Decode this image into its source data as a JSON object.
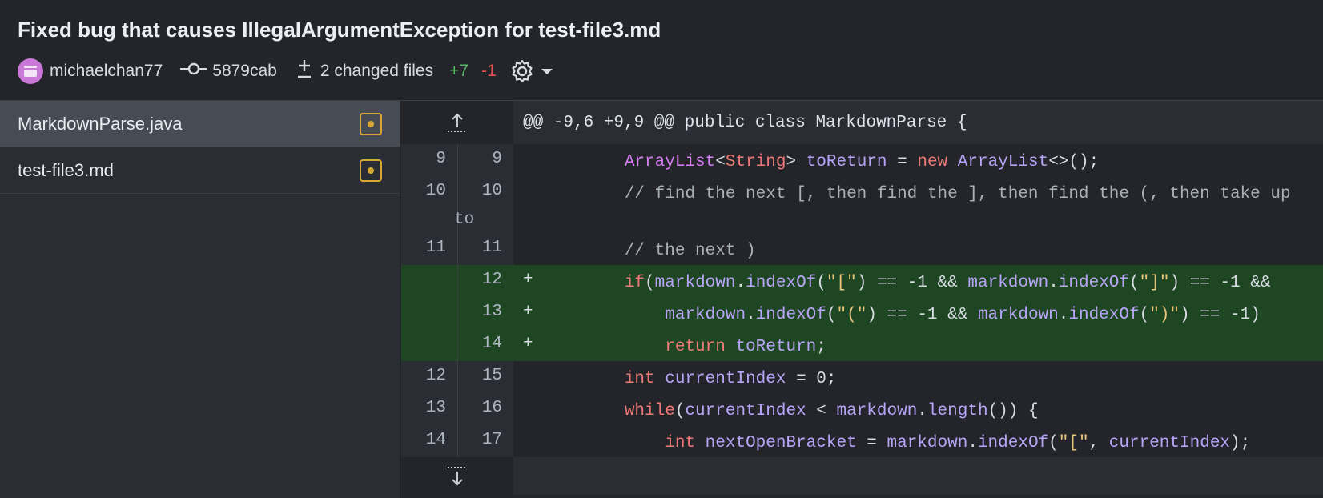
{
  "commit": {
    "title": "Fixed bug that causes IllegalArgumentException for test-file3.md",
    "author": "michaelchan77",
    "sha": "5879cab",
    "changed_files": "2 changed files",
    "additions": "+7",
    "deletions": "-1"
  },
  "files": [
    {
      "name": "MarkdownParse.java",
      "status": "modified",
      "active": true
    },
    {
      "name": "test-file3.md",
      "status": "modified",
      "active": false
    }
  ],
  "diff": {
    "hunk_header": "@@ -9,6 +9,9 @@ public class MarkdownParse {",
    "lines": [
      {
        "old": "9",
        "new": "9",
        "sign": "",
        "type": "context"
      },
      {
        "old": "10",
        "new": "10",
        "sign": "",
        "type": "context"
      },
      {
        "old": "11",
        "new": "11",
        "sign": "",
        "type": "context"
      },
      {
        "old": "",
        "new": "12",
        "sign": "+",
        "type": "added"
      },
      {
        "old": "",
        "new": "13",
        "sign": "+",
        "type": "added"
      },
      {
        "old": "",
        "new": "14",
        "sign": "+",
        "type": "added"
      },
      {
        "old": "12",
        "new": "15",
        "sign": "",
        "type": "context"
      },
      {
        "old": "13",
        "new": "16",
        "sign": "",
        "type": "context"
      },
      {
        "old": "14",
        "new": "17",
        "sign": "",
        "type": "context"
      }
    ],
    "code": {
      "l1_a": "ArrayList",
      "l1_b": "<",
      "l1_c": "String",
      "l1_d": "> ",
      "l1_e": "toReturn",
      "l1_f": " = ",
      "l1_g": "new",
      "l1_h": " ",
      "l1_i": "ArrayList",
      "l1_j": "<>();",
      "l2": "// find the next [, then find the ], then find the (, then take up",
      "l2_wrap": "to",
      "l3": "// the next )",
      "l4_a": "if",
      "l4_b": "(",
      "l4_c": "markdown",
      "l4_d": ".",
      "l4_e": "indexOf",
      "l4_f": "(",
      "l4_g": "\"[\"",
      "l4_h": ") == -1 && ",
      "l4_i": "markdown",
      "l4_j": ".",
      "l4_k": "indexOf",
      "l4_l": "(",
      "l4_m": "\"]\"",
      "l4_n": ") == -1 &&",
      "l5_a": "markdown",
      "l5_b": ".",
      "l5_c": "indexOf",
      "l5_d": "(",
      "l5_e": "\"(\"",
      "l5_f": ") == -1 && ",
      "l5_g": "markdown",
      "l5_h": ".",
      "l5_i": "indexOf",
      "l5_j": "(",
      "l5_k": "\")\"",
      "l5_l": ") == -1)",
      "l6_a": "return",
      "l6_b": " ",
      "l6_c": "toReturn",
      "l6_d": ";",
      "l7_a": "int",
      "l7_b": " ",
      "l7_c": "currentIndex",
      "l7_d": " = 0;",
      "l8_a": "while",
      "l8_b": "(",
      "l8_c": "currentIndex",
      "l8_d": " < ",
      "l8_e": "markdown",
      "l8_f": ".",
      "l8_g": "length",
      "l8_h": "()) {",
      "l9_a": "int",
      "l9_b": " ",
      "l9_c": "nextOpenBracket",
      "l9_d": " = ",
      "l9_e": "markdown",
      "l9_f": ".",
      "l9_g": "indexOf",
      "l9_h": "(",
      "l9_i": "\"[\"",
      "l9_j": ", ",
      "l9_k": "currentIndex",
      "l9_l": ");"
    }
  },
  "colors": {
    "added_bg": "#1e4623",
    "additions": "#56b865",
    "deletions": "#e5534b",
    "modified_icon": "#d7a733"
  }
}
